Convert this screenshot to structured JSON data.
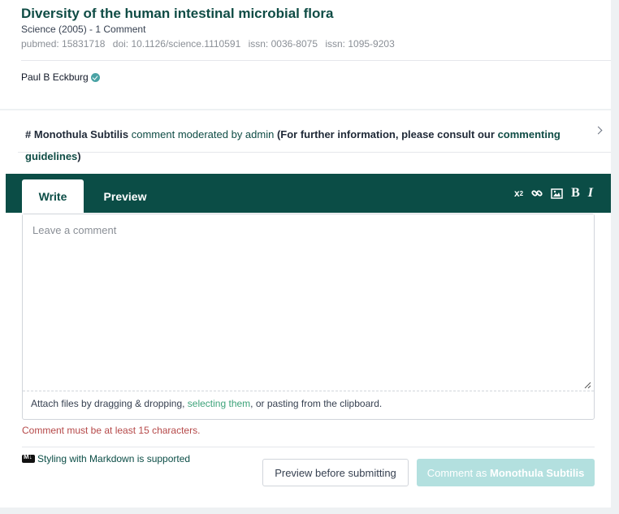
{
  "paper": {
    "title": "Diversity of the human intestinal microbial flora",
    "journal_line": "Science (2005) - 1 Comment",
    "identifiers": [
      "pubmed: 15831718",
      "doi: 10.1126/science.1110591",
      "issn: 0036-8075",
      "issn: 1095-9203"
    ],
    "author": "Paul B Eckburg"
  },
  "moderation": {
    "hash": "#",
    "user": "Monothula Subtilis",
    "middle": "comment moderated by admin",
    "info_prefix": "(For further information, please consult our",
    "link": "commenting guidelines",
    "info_suffix": ")"
  },
  "editor": {
    "tabs": {
      "write": "Write",
      "preview": "Preview"
    },
    "toolbar_icons": [
      "superscript-icon",
      "link-icon",
      "image-icon",
      "bold-icon",
      "italic-icon"
    ],
    "textarea_placeholder": "Leave a comment",
    "attach": {
      "prefix": "Attach files by dragging & dropping,",
      "link": "selecting them",
      "suffix": ", or pasting from the clipboard."
    },
    "error": "Comment must be at least 15 characters.",
    "markdown_note": "Styling with Markdown is supported",
    "preview_button": "Preview before submitting",
    "submit_prefix": "Comment as",
    "submit_user": "Monothula Subtilis"
  },
  "colors": {
    "brand": "#0b4d46",
    "link_green": "#3da37a",
    "error": "#b54848",
    "submit_disabled": "#b3e0df"
  }
}
